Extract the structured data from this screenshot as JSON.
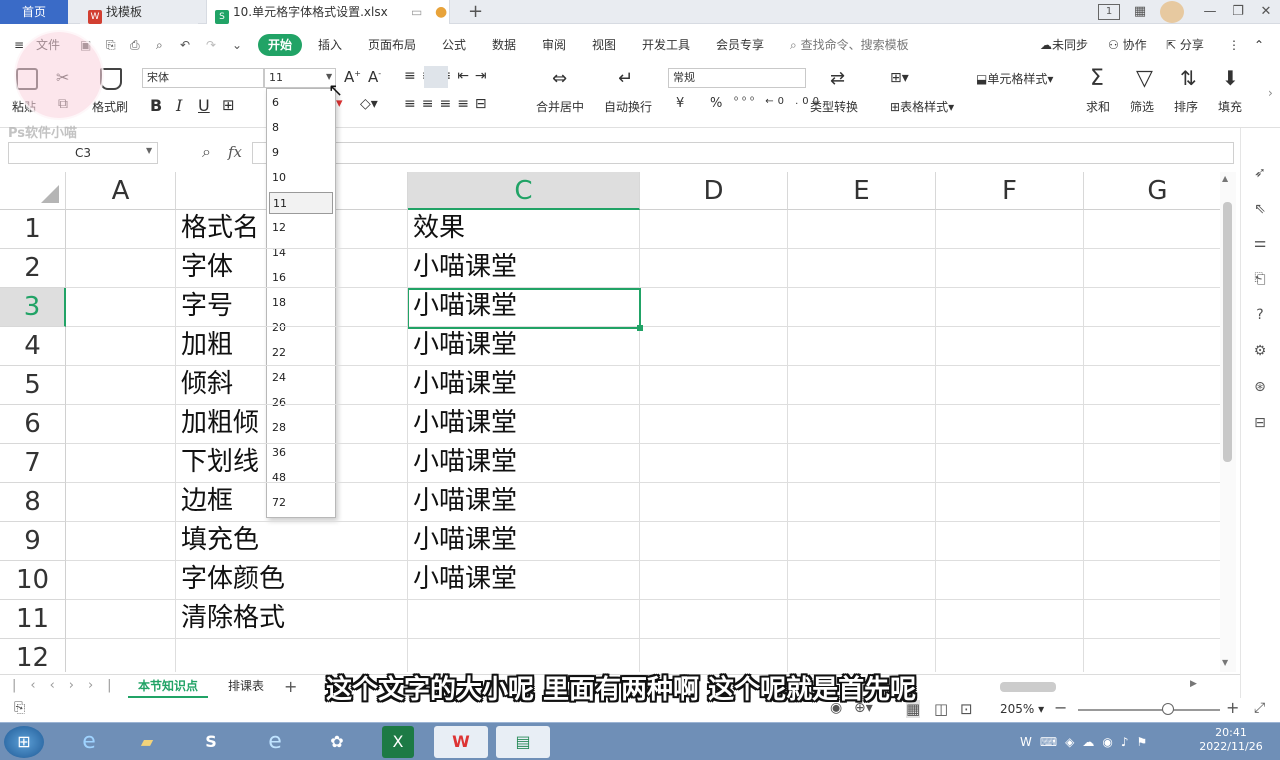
{
  "tabs": {
    "home": "首页",
    "template": "找模板",
    "file": "10.单元格字体格式设置.xlsx"
  },
  "menu": {
    "file": "文件",
    "start": "开始",
    "insert": "插入",
    "layout": "页面布局",
    "formula": "公式",
    "data": "数据",
    "review": "审阅",
    "view": "视图",
    "dev": "开发工具",
    "vip": "会员专享",
    "search": "查找命令、搜索模板",
    "unsync": "未同步",
    "collab": "协作",
    "share": "分享"
  },
  "ribbon": {
    "paste": "粘贴",
    "format_painter": "格式刷",
    "font_name": "宋体",
    "font_size": "11",
    "bold": "B",
    "italic": "I",
    "underline": "U",
    "merge": "合并居中",
    "wrap": "自动换行",
    "number_format": "常规",
    "type_convert": "类型转换",
    "cond_format": "条件格式",
    "table_style": "表格样式",
    "cell_style": "单元格样式",
    "sum": "求和",
    "filter": "筛选",
    "sort": "排序",
    "fill": "填充",
    "currency": "¥",
    "percent": "%"
  },
  "formula_bar": {
    "name_box": "C3",
    "fx": "fx"
  },
  "columns": [
    "A",
    "C",
    "D",
    "E",
    "F",
    "G"
  ],
  "rows": [
    "1",
    "2",
    "3",
    "4",
    "5",
    "6",
    "7",
    "8",
    "9",
    "10",
    "11",
    "12"
  ],
  "col_b_values": [
    "格式名",
    "字体",
    "字号",
    "加粗",
    "倾斜",
    "加粗倾",
    "下划线",
    "边框",
    "填充色",
    "字体颜色",
    "清除格式"
  ],
  "col_c_values": [
    "效果",
    "小喵课堂",
    "小喵课堂",
    "小喵课堂",
    "小喵课堂",
    "小喵课堂",
    "小喵课堂",
    "小喵课堂",
    "小喵课堂",
    "小喵课堂"
  ],
  "font_sizes": [
    "6",
    "8",
    "9",
    "10",
    "11",
    "12",
    "14",
    "16",
    "18",
    "20",
    "22",
    "24",
    "26",
    "28",
    "36",
    "48",
    "72"
  ],
  "selected_font_size": "11",
  "sheets": {
    "active": "本节知识点",
    "other": "排课表"
  },
  "status": {
    "zoom": "205%"
  },
  "subtitle": "这个文字的大小呢 里面有两种啊 这个呢就是首先呢",
  "clock": {
    "time": "20:41",
    "date": "2022/11/26"
  },
  "watermark": "Ps软件小喵",
  "colors": {
    "accent_green": "#21a366",
    "home_tab_blue": "#3a6bc7",
    "taskbar": "#6f8fb7"
  }
}
